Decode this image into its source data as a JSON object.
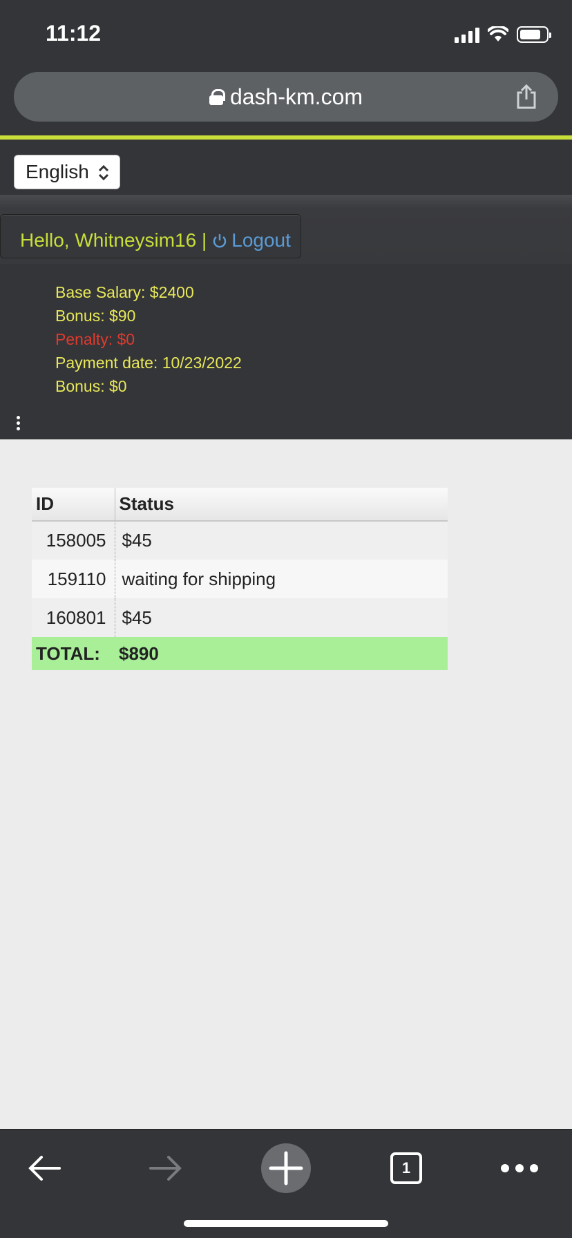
{
  "status_bar": {
    "time": "11:12"
  },
  "browser": {
    "url": "dash-km.com",
    "tab_count": "1"
  },
  "header": {
    "language": "English",
    "greeting": "Hello, Whitneysim16 |",
    "logout_label": "Logout"
  },
  "salary": {
    "base_salary": "Base Salary: $2400",
    "bonus": "Bonus: $90",
    "penalty": "Penalty: $0",
    "payment_date": "Payment date: 10/23/2022",
    "bonus2": "Bonus: $0"
  },
  "table": {
    "headers": {
      "id": "ID",
      "status": "Status"
    },
    "rows": [
      {
        "id": "158005",
        "status": "$45"
      },
      {
        "id": "159110",
        "status": "waiting for shipping"
      },
      {
        "id": "160801",
        "status": "$45"
      }
    ],
    "total_label": "TOTAL:",
    "total_value": "$890"
  },
  "colors": {
    "accent": "#c8de3a",
    "link": "#5b9bd5",
    "penalty": "#e03a2e",
    "salary_text": "#e8e85a",
    "total_row": "#a8ef98",
    "chrome": "#343538"
  },
  "icons": {
    "lock": "lock-icon",
    "share": "share-icon",
    "power": "power-icon",
    "more": "more-vertical-icon",
    "back": "arrow-left-icon",
    "forward": "arrow-right-icon",
    "new_tab": "plus-icon",
    "tabs": "tabs-icon",
    "menu": "more-horizontal-icon"
  }
}
